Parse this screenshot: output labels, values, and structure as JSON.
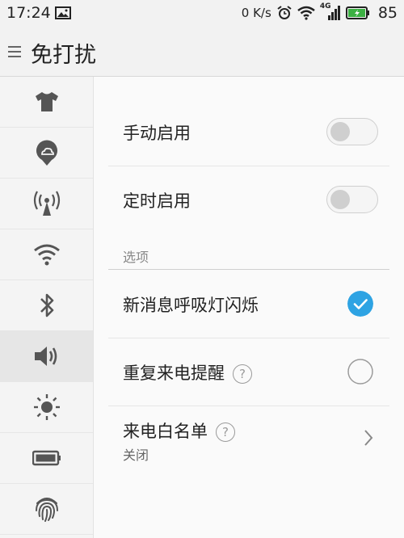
{
  "status_bar": {
    "time": "17:24",
    "speed": "0 K/s",
    "network": "4G",
    "battery_percent": "85"
  },
  "header": {
    "title": "免打扰"
  },
  "sidebar": {
    "items": [
      {
        "icon": "shirt-icon"
      },
      {
        "icon": "cloud-location-icon"
      },
      {
        "icon": "hotspot-icon"
      },
      {
        "icon": "wifi-icon"
      },
      {
        "icon": "bluetooth-icon"
      },
      {
        "icon": "sound-icon",
        "active": true
      },
      {
        "icon": "brightness-icon"
      },
      {
        "icon": "battery-icon"
      },
      {
        "icon": "fingerprint-icon"
      }
    ]
  },
  "settings": {
    "manual_enable": {
      "label": "手动启用",
      "enabled": false
    },
    "scheduled_enable": {
      "label": "定时启用",
      "enabled": false
    },
    "options_section": "选项",
    "led_blink": {
      "label": "新消息呼吸灯闪烁",
      "checked": true
    },
    "repeat_call": {
      "label": "重复来电提醒",
      "help": "?",
      "checked": false
    },
    "call_whitelist": {
      "label": "来电白名单",
      "help": "?",
      "value": "关闭"
    }
  },
  "colors": {
    "accent": "#2ea3e3",
    "battery_green": "#3cb043"
  }
}
